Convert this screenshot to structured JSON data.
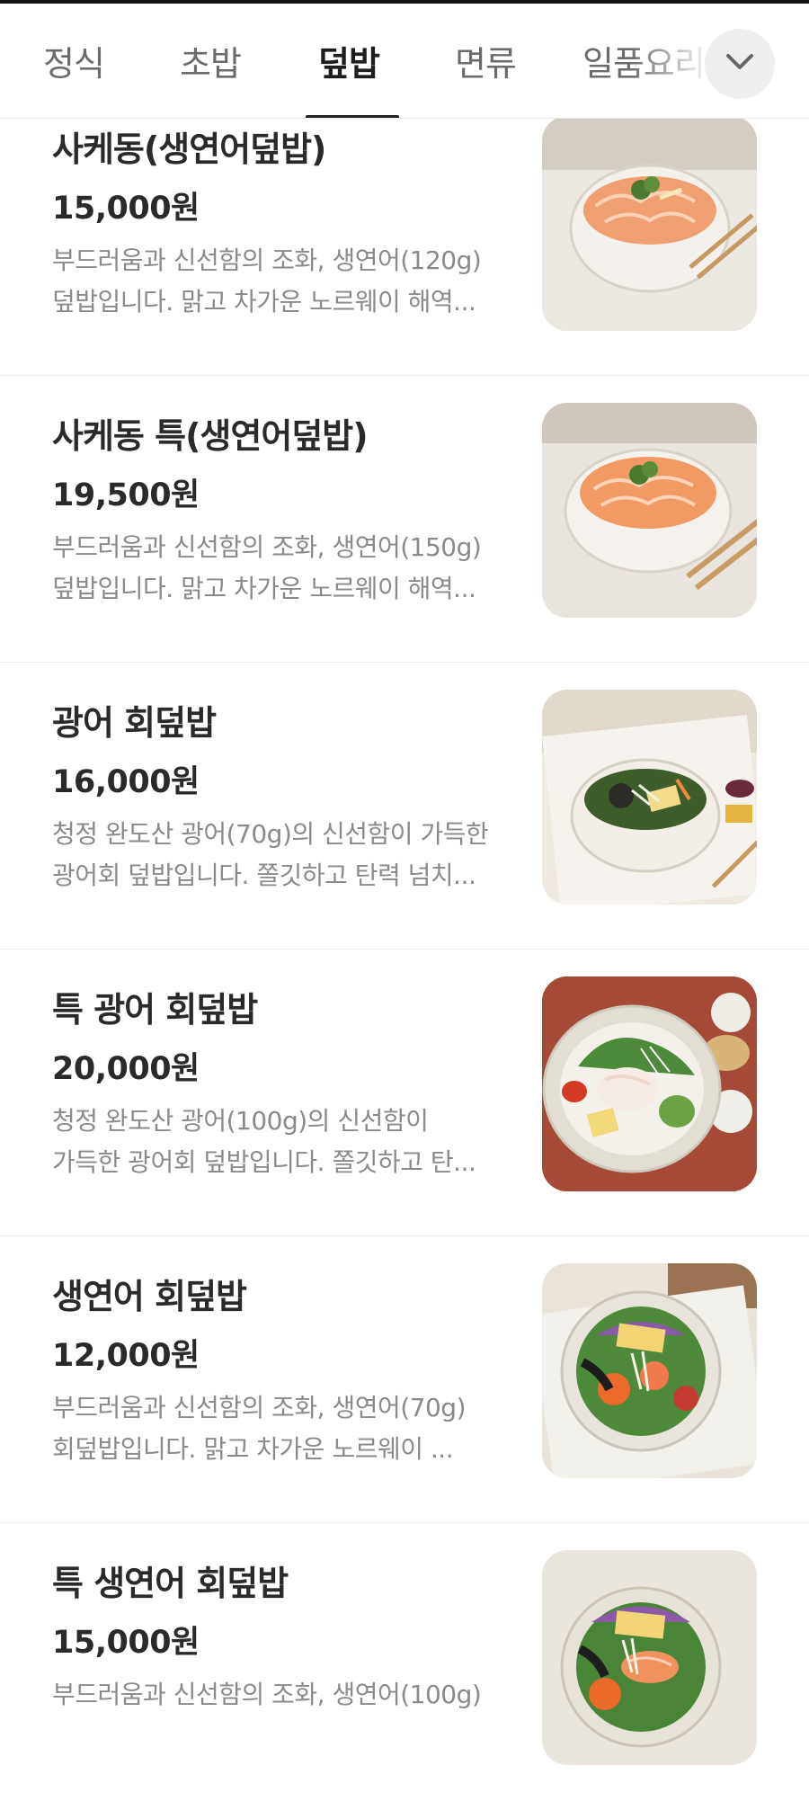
{
  "tabs": [
    {
      "label": "정식",
      "active": false
    },
    {
      "label": "초밥",
      "active": false
    },
    {
      "label": "덮밥",
      "active": true
    },
    {
      "label": "면류",
      "active": false
    },
    {
      "label": "일품요리",
      "active": false
    }
  ],
  "expand_icon": "chevron-down-icon",
  "menu_items": [
    {
      "name": "사케동(생연어덮밥)",
      "price": "15,000원",
      "desc_line1": "부드러움과 신선함의 조화, 생연어(120g)",
      "desc_line2": "덮밥입니다. 맑고 차가운 노르웨이 해역..."
    },
    {
      "name": "사케동 특(생연어덮밥)",
      "price": "19,500원",
      "desc_line1": "부드러움과 신선함의 조화, 생연어(150g)",
      "desc_line2": "덮밥입니다. 맑고 차가운 노르웨이 해역..."
    },
    {
      "name": "광어 회덮밥",
      "price": "16,000원",
      "desc_line1": "청정 완도산 광어(70g)의 신선함이 가득한",
      "desc_line2": "광어회 덮밥입니다. 쫄깃하고 탄력 넘치..."
    },
    {
      "name": "특 광어 회덮밥",
      "price": "20,000원",
      "desc_line1": "청정 완도산 광어(100g)의 신선함이",
      "desc_line2": "가득한 광어회 덮밥입니다. 쫄깃하고 탄..."
    },
    {
      "name": "생연어 회덮밥",
      "price": "12,000원",
      "desc_line1": "부드러움과 신선함의 조화, 생연어(70g)",
      "desc_line2": "회덮밥입니다. 맑고 차가운 노르웨이 ..."
    },
    {
      "name": "특 생연어 회덮밥",
      "price": "15,000원",
      "desc_line1": "부드러움과 신선함의 조화, 생연어(100g)",
      "desc_line2": ""
    }
  ]
}
